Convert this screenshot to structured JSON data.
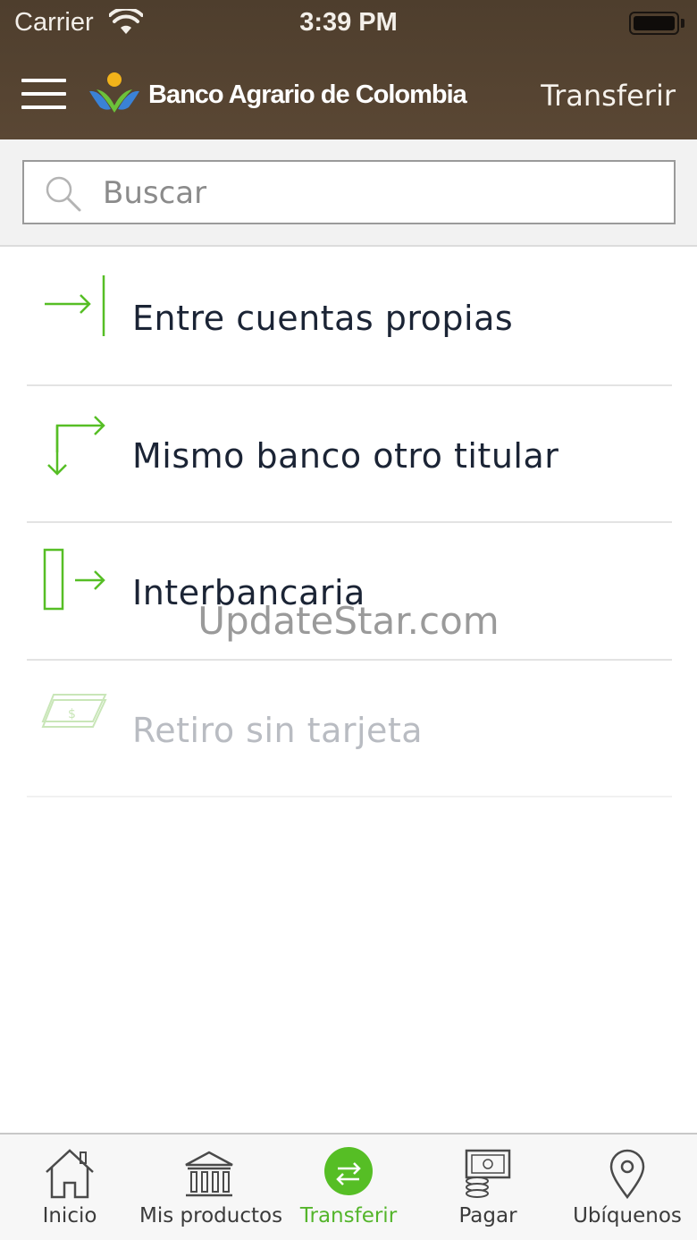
{
  "status_bar": {
    "carrier": "Carrier",
    "time": "3:39 PM"
  },
  "nav": {
    "brand_name": "Banco Agrario de Colombia",
    "title": "Transferir"
  },
  "search": {
    "placeholder": "Buscar"
  },
  "menu": {
    "items": [
      {
        "label": "Entre cuentas propias",
        "icon": "arrow-to-bar-icon",
        "enabled": true
      },
      {
        "label": "Mismo banco otro titular",
        "icon": "corner-arrows-icon",
        "enabled": true
      },
      {
        "label": "Interbancaria",
        "icon": "bank-out-arrow-icon",
        "enabled": true
      },
      {
        "label": "Retiro sin tarjeta",
        "icon": "cash-bill-icon",
        "enabled": false
      }
    ]
  },
  "watermark": "UpdateStar.com",
  "tab_bar": {
    "tabs": [
      {
        "label": "Inicio",
        "icon": "home-icon",
        "active": false
      },
      {
        "label": "Mis productos",
        "icon": "bank-building-icon",
        "active": false
      },
      {
        "label": "Transferir",
        "icon": "transfer-arrows-icon",
        "active": true
      },
      {
        "label": "Pagar",
        "icon": "bill-coins-icon",
        "active": false
      },
      {
        "label": "Ubíquenos",
        "icon": "location-pin-icon",
        "active": false
      }
    ]
  },
  "colors": {
    "header_brown": "#574431",
    "accent_green": "#56be25",
    "text_dark": "#1b2435",
    "text_disabled": "#b9bcc2"
  }
}
